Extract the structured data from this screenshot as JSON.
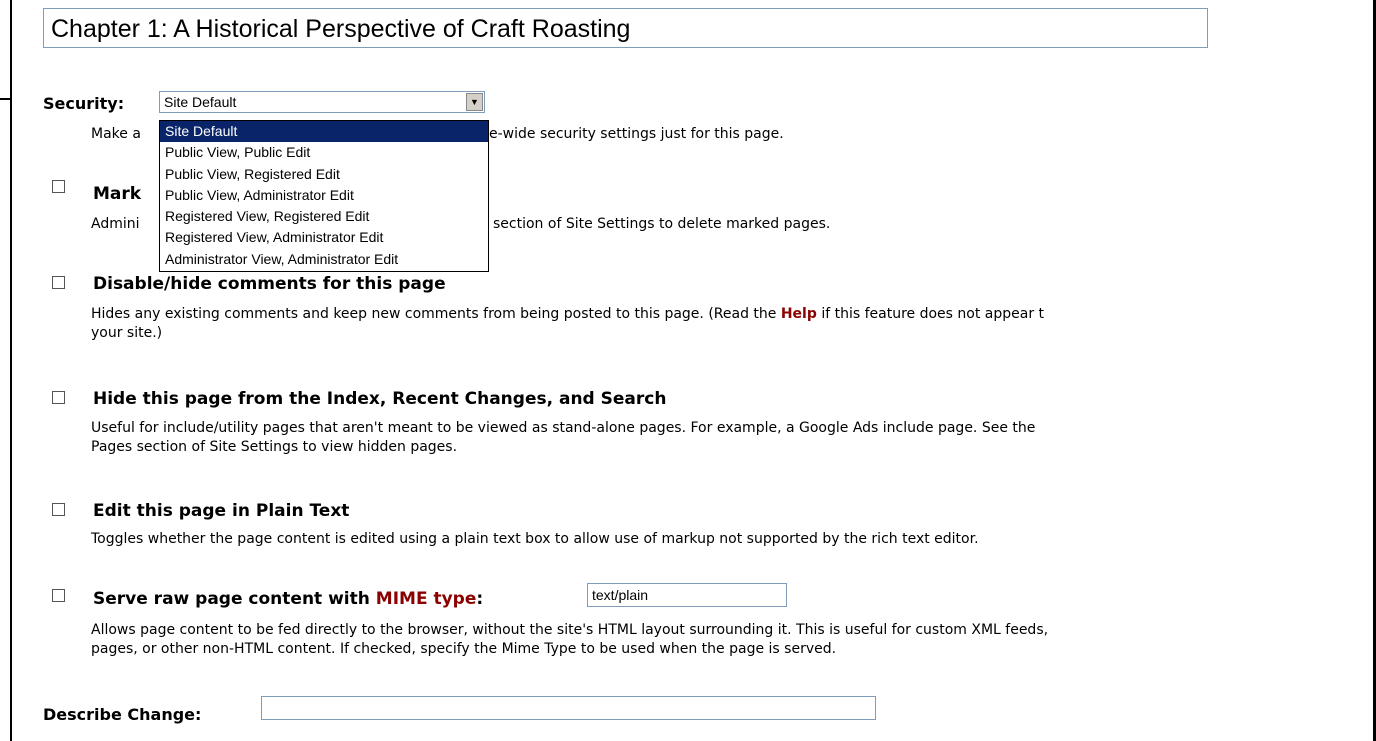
{
  "page_title": "Chapter 1: A Historical Perspective of Craft Roasting",
  "security": {
    "label": "Security:",
    "selected": "Site Default",
    "desc_start": "Make a",
    "desc_end": "e-wide security settings just for this page.",
    "options": [
      "Site Default",
      "Public View, Public Edit",
      "Public View, Registered Edit",
      "Public View, Administrator Edit",
      "Registered View, Registered Edit",
      "Registered View, Administrator Edit",
      "Administrator View, Administrator Edit"
    ]
  },
  "mark": {
    "label": "Mark",
    "desc_start": "Admini",
    "desc_end": "section of Site Settings to delete marked pages."
  },
  "disable_comments": {
    "label": "Disable/hide comments for this page",
    "desc_1_before": "Hides any existing comments and keep new comments from being posted to this page. (Read the ",
    "help_link": "Help",
    "desc_1_after": " if this feature does not appear t",
    "desc_2": "your site.)"
  },
  "hide_page": {
    "label": "Hide this page from the Index, Recent Changes, and Search",
    "desc_1": "Useful for include/utility pages that aren't meant to be viewed as stand-alone pages. For example, a Google Ads include page. See the",
    "desc_2": "Pages section of Site Settings to view hidden pages."
  },
  "plain_text": {
    "label": "Edit this page in Plain Text",
    "desc": "Toggles whether the page content is edited using a plain text box to allow use of markup not supported by the rich text editor."
  },
  "raw_content": {
    "label_before": "Serve raw page content with ",
    "mime_label": "MIME type",
    "label_after": ":",
    "input_value": "text/plain",
    "desc_1": "Allows page content to be fed directly to the browser, without the site's HTML layout surrounding it. This is useful for custom XML feeds,",
    "desc_2": "pages, or other non-HTML content. If checked, specify the Mime Type to be used when the page is served."
  },
  "describe_change": {
    "label": "Describe Change:",
    "input_value": ""
  },
  "icons": {
    "dropdown_arrow": "chevron-down-icon"
  },
  "colors": {
    "link": "#8b0000",
    "selection": "#0a246a",
    "input_border": "#7f9db9"
  }
}
